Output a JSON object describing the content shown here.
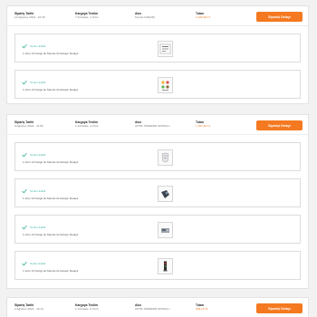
{
  "labels": {
    "date": "Sipariş Tarihi",
    "delivery": "Kargoya Teslim",
    "address": "Alıcı",
    "total": "Tutarı",
    "button": "Siparişi Detayı"
  },
  "item_status": "Teslim Edildi",
  "item_desc": "1 ürün 13 Kargo ile Mende ile Detaylı Detaylı",
  "orders": [
    {
      "date": "13 Ağustos 2024 - 16:39",
      "delivery": "7 Kırıkkale, 1 Ürün",
      "address": "Kemal CAN(28)",
      "total": "1.049,99 TL"
    },
    {
      "date": "9 Ağustos 2024 - 11:56",
      "delivery": "1 Kırıkkale, 4 Ürün",
      "address": "AHTİF ÖZDEMİR ORTAKLI...",
      "total": "1.397,64 TL"
    },
    {
      "date": "2 Ağustos 2024 - 19:13",
      "delivery": "1 Kırıkkale, 8 Ürün",
      "address": "AHTİF ÖZDEMİR ORTAKLI...",
      "total": "936,16 TL"
    }
  ]
}
